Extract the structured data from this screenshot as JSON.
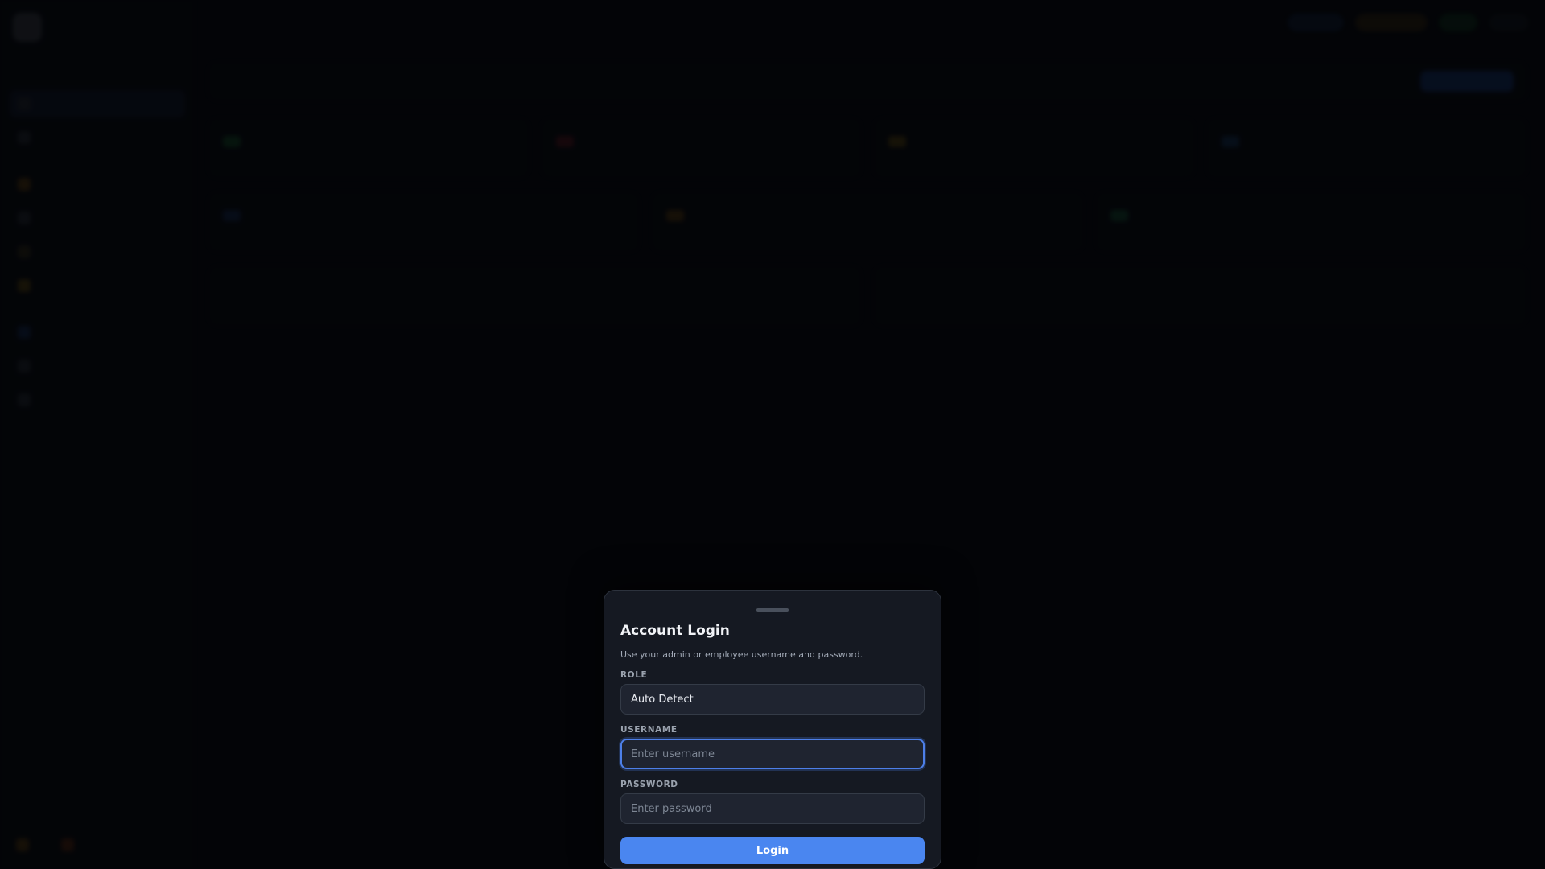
{
  "modal": {
    "title": "Account Login",
    "subtitle": "Use your admin or employee username and password.",
    "role_label": "ROLE",
    "role_value": "Auto Detect",
    "username_label": "USERNAME",
    "username_placeholder": "Enter username",
    "password_label": "PASSWORD",
    "password_placeholder": "Enter password",
    "login_label": "Login"
  },
  "colors": {
    "accent": "#4a86f0",
    "modal_bg": "#151922",
    "page_bg": "#05070b"
  }
}
